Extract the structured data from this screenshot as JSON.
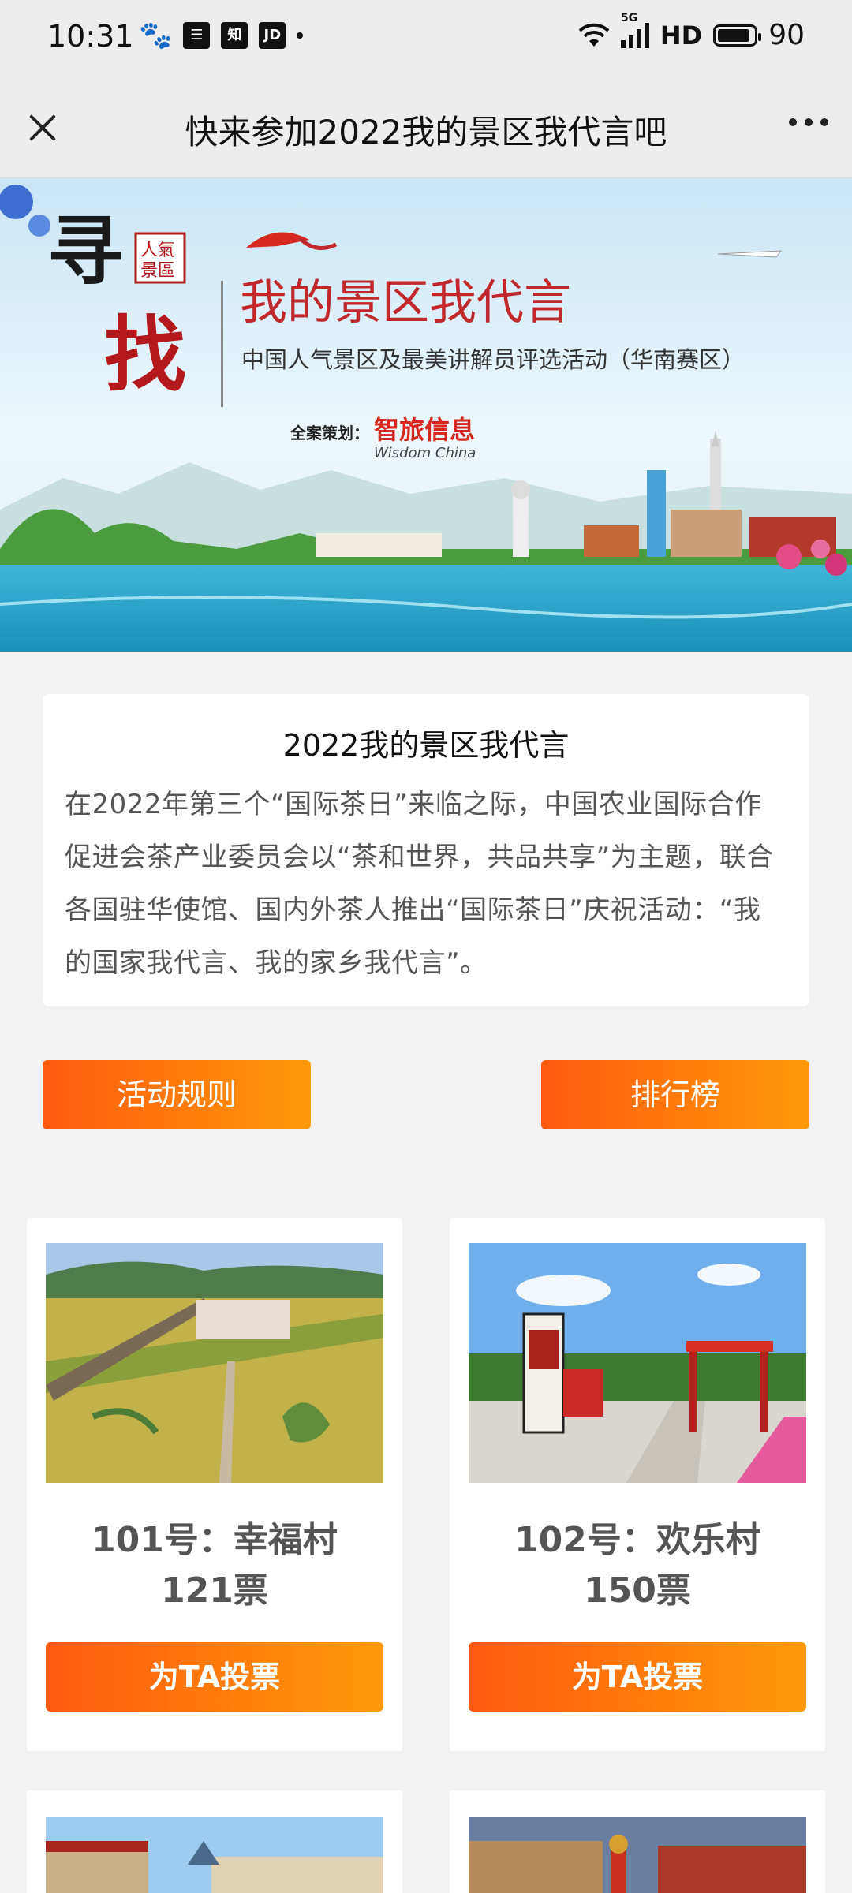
{
  "status_bar": {
    "time": "10:31",
    "icons_left": [
      "paw-icon",
      "list-icon",
      "zhihu-icon",
      "jd-icon"
    ],
    "zhihu_label": "知",
    "jd_label": "JD",
    "network": "5G",
    "hd": "HD",
    "battery": "90",
    "battery_level": 0.9
  },
  "title_bar": {
    "title": "快来参加2022我的景区我代言吧"
  },
  "banner": {
    "title_chars": "寻",
    "title_chars2": "找",
    "seal_text": "人氣景區",
    "headline": "我的景区我代言",
    "subline": "中国人气景区及最美讲解员评选活动（华南赛区）",
    "planner_label": "全案策划：",
    "planner_name": "智旅信息",
    "planner_en": "Wisdom China"
  },
  "intro": {
    "title": "2022我的景区我代言",
    "text": "在2022年第三个“国际茶日”来临之际，中国农业国际合作促进会茶产业委员会以“茶和世界，共品共享”为主题，联合各国驻华使馆、国内外茶人推出“国际茶日”庆祝活动：“我的国家我代言、我的家乡我代言”。"
  },
  "actions": {
    "rules_label": "活动规则",
    "ranking_label": "排行榜"
  },
  "entries": [
    {
      "name": "101号：幸福村",
      "votes": "121票",
      "vote_label": "为TA投票"
    },
    {
      "name": "102号：欢乐村",
      "votes": "150票",
      "vote_label": "为TA投票"
    }
  ],
  "colors": {
    "accent_start": "#ff5a0f",
    "accent_end": "#ff9a0a",
    "headline_red": "#c0282c"
  }
}
